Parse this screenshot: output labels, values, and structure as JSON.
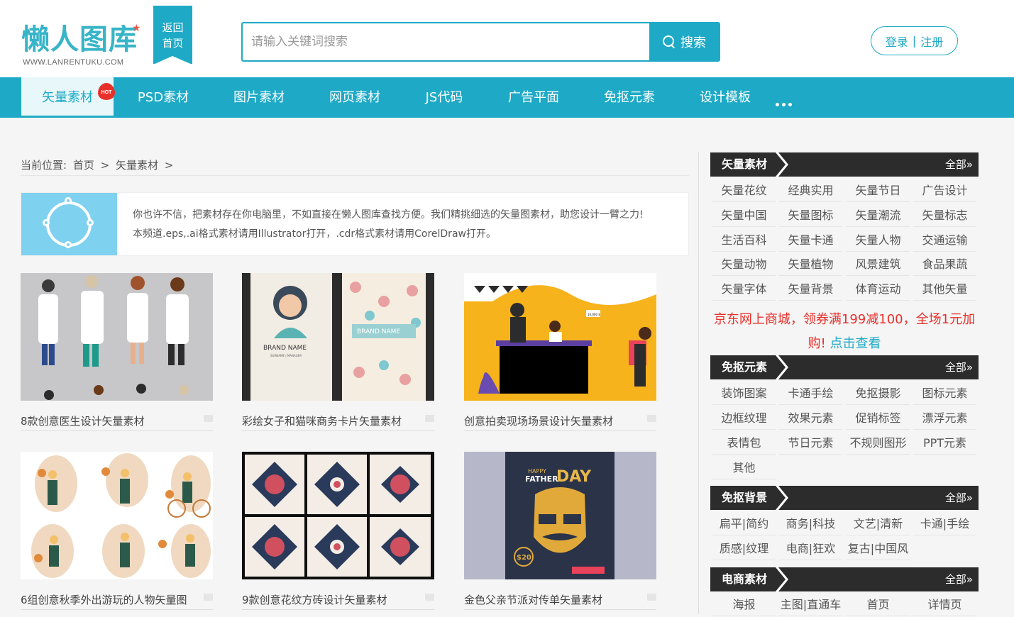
{
  "header": {
    "logo_text": "懒人图库",
    "logo_url": "WWW.LANRENTUKU.COM",
    "back_home_line1": "返回",
    "back_home_line2": "首页",
    "search_placeholder": "请输入关键词搜索",
    "search_button": "搜索",
    "login": "登录",
    "separator": "|",
    "register": "注册"
  },
  "nav": {
    "items": [
      "矢量素材",
      "PSD素材",
      "图片素材",
      "网页素材",
      "JS代码",
      "广告平面",
      "免抠元素",
      "设计模板"
    ],
    "hot_badge": "HOT"
  },
  "breadcrumb": {
    "label": "当前位置:",
    "home": "首页",
    "sep": ">",
    "current": "矢量素材",
    "sep2": ">"
  },
  "intro": {
    "line1": "你也许不信，把素材存在你电脑里，不如直接在懒人图库查找方便。我们精挑细选的矢量图素材，助您设计一臂之力!",
    "line2": "本频道.eps,.ai格式素材请用Illustrator打开，.cdr格式素材请用CorelDraw打开。"
  },
  "grid": [
    {
      "title": "8款创意医生设计矢量素材"
    },
    {
      "title": "彩绘女子和猫咪商务卡片矢量素材"
    },
    {
      "title": "创意拍卖现场场景设计矢量素材"
    },
    {
      "title": "6组创意秋季外出游玩的人物矢量图"
    },
    {
      "title": "9款创意花纹方砖设计矢量素材"
    },
    {
      "title": "金色父亲节派对传单矢量素材"
    }
  ],
  "thumb_text": {
    "brand_name": "BRAND NAME",
    "surname": "SURNAME | MANAGER",
    "happy": "HAPPY",
    "father": "FATHER",
    "day": "DAY",
    "price": "$20",
    "price_badge": "10,000 $"
  },
  "sidebar": {
    "all_label": "全部»",
    "sections": [
      {
        "title": "矢量素材",
        "links": [
          "矢量花纹",
          "经典实用",
          "矢量节日",
          "广告设计",
          "矢量中国",
          "矢量图标",
          "矢量潮流",
          "矢量标志",
          "生活百科",
          "矢量卡通",
          "矢量人物",
          "交通运输",
          "矢量动物",
          "矢量植物",
          "风景建筑",
          "食品果蔬",
          "矢量字体",
          "矢量背景",
          "体育运动",
          "其他矢量"
        ]
      },
      {
        "title": "免抠元素",
        "links": [
          "装饰图案",
          "卡通手绘",
          "免抠摄影",
          "图标元素",
          "边框纹理",
          "效果元素",
          "促销标签",
          "漂浮元素",
          "表情包",
          "节日元素",
          "不规则图形",
          "PPT元素",
          "其他"
        ]
      },
      {
        "title": "免抠背景",
        "links": [
          "扁平|简约",
          "商务|科技",
          "文艺|清新",
          "卡通|手绘",
          "质感|纹理",
          "电商|狂欢",
          "复古|中国风"
        ]
      },
      {
        "title": "电商素材",
        "links": [
          "海报",
          "主图|直通车",
          "首页",
          "详情页"
        ]
      }
    ],
    "ad_text": "京东网上商城，领券满199减100，全场1元加购!",
    "ad_link": "点击查看"
  },
  "colors": {
    "accent": "#1eaac6",
    "dark": "#2c2c2c",
    "ad_red": "#e8302a"
  }
}
